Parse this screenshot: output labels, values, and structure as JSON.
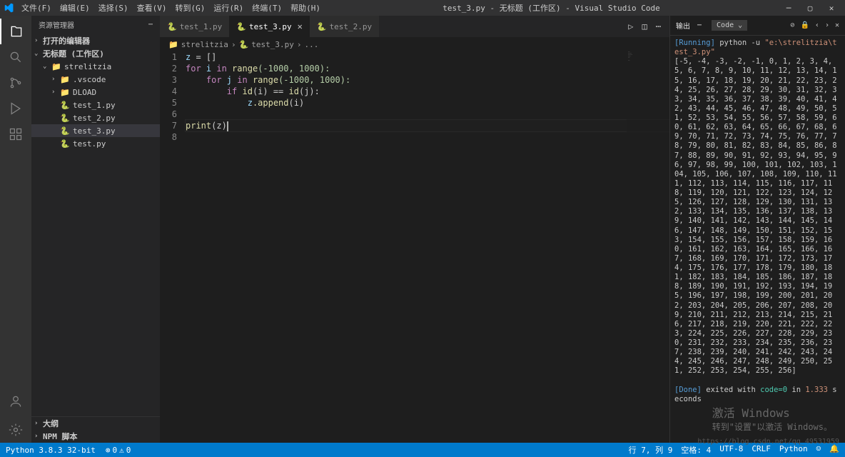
{
  "menu": {
    "file": "文件(F)",
    "edit": "编辑(E)",
    "select": "选择(S)",
    "view": "查看(V)",
    "goto": "转到(G)",
    "run": "运行(R)",
    "terminal": "终端(T)",
    "help": "帮助(H)"
  },
  "title": "test_3.py - 无标题 (工作区) - Visual Studio Code",
  "sidebar": {
    "header": "资源管理器",
    "open_editors": "打开的编辑器",
    "workspace": "无标题 (工作区)",
    "folder_root": "strelitzia",
    "folder_vscode": ".vscode",
    "folder_dload": "DLOAD",
    "files": [
      "test_1.py",
      "test_2.py",
      "test_3.py",
      "test.py"
    ],
    "outline": "大纲",
    "npm": "NPM 脚本"
  },
  "tabs": {
    "t1": "test_1.py",
    "t2": "test_3.py",
    "t3": "test_2.py"
  },
  "breadcrumb": {
    "b1": "strelitzia",
    "b2": "test_3.py",
    "b3": "..."
  },
  "code": {
    "l1_var": "z",
    "l1_op": " = []",
    "l2_for": "for",
    "l2_i": " i ",
    "l2_in": "in",
    "l2_range": " range",
    "l2_args": "(-1000, 1000):",
    "l3_for": "    for",
    "l3_j": " j ",
    "l3_in": "in",
    "l3_range": " range",
    "l3_args": "(-1000, 1000):",
    "l4_if": "        if",
    "l4_id1": " id",
    "l4_par1": "(i) == ",
    "l4_id2": "id",
    "l4_par2": "(j):",
    "l5_pre": "            ",
    "l5_z": "z",
    "l5_app": ".append",
    "l5_arg": "(i)",
    "l7_print": "print",
    "l7_arg": "(z)",
    "line_numbers": [
      "1",
      "2",
      "3",
      "4",
      "5",
      "6",
      "7",
      "8"
    ]
  },
  "panel": {
    "tab_output": "输出",
    "dropdown": "Code",
    "running": "[Running]",
    "cmd_pre": " python -u ",
    "cmd_path": "\"e:\\strelitzia\\test_3.py\"",
    "list_output": "[-5, -4, -3, -2, -1, 0, 1, 2, 3, 4, 5, 6, 7, 8, 9, 10, 11, 12, 13, 14, 15, 16, 17, 18, 19, 20, 21, 22, 23, 24, 25, 26, 27, 28, 29, 30, 31, 32, 33, 34, 35, 36, 37, 38, 39, 40, 41, 42, 43, 44, 45, 46, 47, 48, 49, 50, 51, 52, 53, 54, 55, 56, 57, 58, 59, 60, 61, 62, 63, 64, 65, 66, 67, 68, 69, 70, 71, 72, 73, 74, 75, 76, 77, 78, 79, 80, 81, 82, 83, 84, 85, 86, 87, 88, 89, 90, 91, 92, 93, 94, 95, 96, 97, 98, 99, 100, 101, 102, 103, 104, 105, 106, 107, 108, 109, 110, 111, 112, 113, 114, 115, 116, 117, 118, 119, 120, 121, 122, 123, 124, 125, 126, 127, 128, 129, 130, 131, 132, 133, 134, 135, 136, 137, 138, 139, 140, 141, 142, 143, 144, 145, 146, 147, 148, 149, 150, 151, 152, 153, 154, 155, 156, 157, 158, 159, 160, 161, 162, 163, 164, 165, 166, 167, 168, 169, 170, 171, 172, 173, 174, 175, 176, 177, 178, 179, 180, 181, 182, 183, 184, 185, 186, 187, 188, 189, 190, 191, 192, 193, 194, 195, 196, 197, 198, 199, 200, 201, 202, 203, 204, 205, 206, 207, 208, 209, 210, 211, 212, 213, 214, 215, 216, 217, 218, 219, 220, 221, 222, 223, 224, 225, 226, 227, 228, 229, 230, 231, 232, 233, 234, 235, 236, 237, 238, 239, 240, 241, 242, 243, 244, 245, 246, 247, 248, 249, 250, 251, 252, 253, 254, 255, 256]",
    "done": "[Done]",
    "done_text1": " exited with ",
    "done_code": "code=0",
    "done_text2": " in ",
    "done_time": "1.333",
    "done_text3": " seconds"
  },
  "statusbar": {
    "python": "Python 3.8.3 32-bit",
    "errors": "0",
    "warnings": "0",
    "pos": "行 7, 列 9",
    "spaces": "空格: 4",
    "encoding": "UTF-8",
    "eol": "CRLF",
    "lang": "Python"
  },
  "watermark": {
    "w1": "激活 Windows",
    "w2": "转到\"设置\"以激活 Windows。"
  },
  "csdn": "https://blog.csdn.net/qq_49531959"
}
